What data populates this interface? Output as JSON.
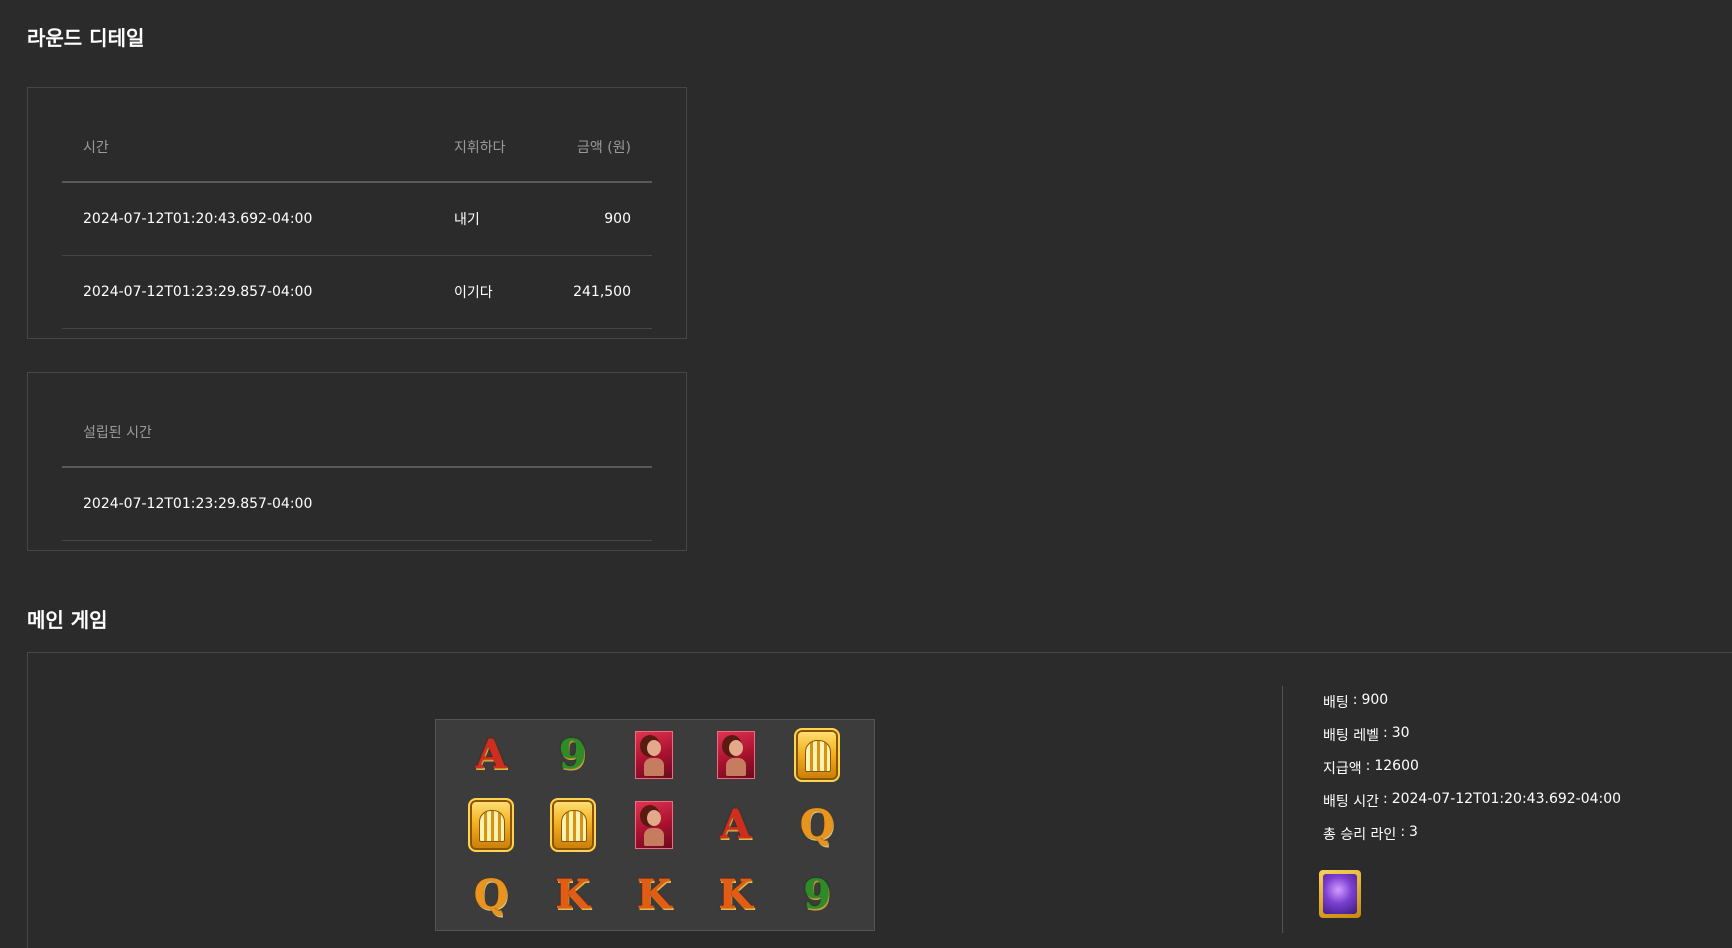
{
  "round_detail": {
    "title": "라운드 디테일",
    "headers": {
      "time": "시간",
      "action": "지휘하다",
      "amount": "금액 (원)"
    },
    "rows": [
      {
        "time": "2024-07-12T01:20:43.692-04:00",
        "action": "내기",
        "amount": "900"
      },
      {
        "time": "2024-07-12T01:23:29.857-04:00",
        "action": "이기다",
        "amount": "241,500"
      }
    ]
  },
  "settlement": {
    "header": "설립된 시간",
    "time": "2024-07-12T01:23:29.857-04:00"
  },
  "main_game": {
    "title": "메인 게임",
    "reels": [
      [
        "A",
        "9",
        "woman",
        "woman",
        "temple"
      ],
      [
        "temple",
        "temple",
        "woman",
        "A",
        "Q"
      ],
      [
        "Q",
        "K",
        "K",
        "K",
        "9"
      ]
    ],
    "info": [
      {
        "label": "배팅",
        "value": "900"
      },
      {
        "label": "배팅 레벨",
        "value": "30"
      },
      {
        "label": "지급액",
        "value": "12600"
      },
      {
        "label": "배팅 시간",
        "value": "2024-07-12T01:20:43.692-04:00"
      },
      {
        "label": "총 승리 라인",
        "value": "3"
      }
    ],
    "scatter_icon": "purple-gem-scatter-icon"
  },
  "colors": {
    "background": "#2c2b2c",
    "border": "#474647",
    "muted_text": "#9a9a9a"
  }
}
